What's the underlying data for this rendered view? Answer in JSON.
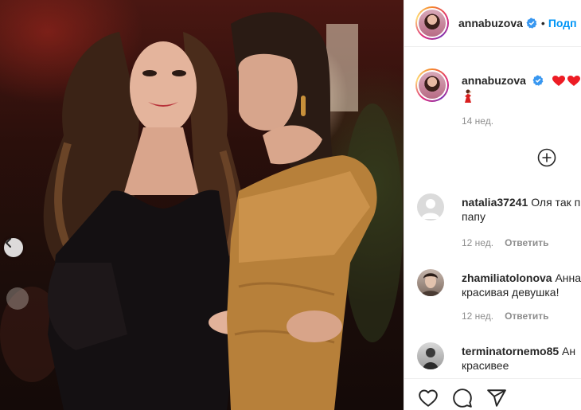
{
  "post": {
    "image_alt": "",
    "carousel_prev_icon": "chevron-left-icon"
  },
  "header": {
    "username": "annabuzova",
    "separator": "•",
    "follow_label": "Подп"
  },
  "caption": {
    "username": "annabuzova",
    "emoji_hearts": [
      "❤",
      "❤",
      "❤"
    ],
    "emoji_extra": "💃",
    "time": "14 нед."
  },
  "load_more_icon": "plus-circle-icon",
  "comments": [
    {
      "username": "natalia37241",
      "text_line1": "Оля так п",
      "text_line2": "папу",
      "time": "12 нед.",
      "reply_label": "Ответить"
    },
    {
      "username": "zhamiliatolonova",
      "text_line1": "Анна",
      "text_line2": "красивая девушка!",
      "time": "12 нед.",
      "reply_label": "Ответить"
    },
    {
      "username": "terminatornemo85",
      "text_line1": "Ан",
      "text_line2": "красивее"
    }
  ],
  "actions": {
    "like_icon": "heart-icon",
    "comment_icon": "comment-icon",
    "share_icon": "paper-plane-icon"
  },
  "colors": {
    "link_blue": "#0095f6",
    "heart_red": "#ed4956",
    "verified_blue": "#3897f0",
    "meta_gray": "#8e8e8e"
  }
}
